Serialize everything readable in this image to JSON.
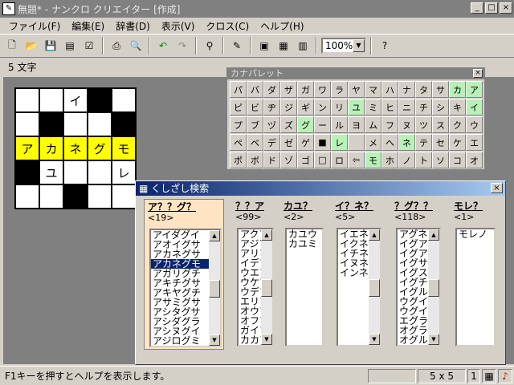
{
  "window": {
    "title": "無題* - ナンクロ クリエイター [作成]",
    "icon": "app-icon"
  },
  "menu": [
    "ファイル(F)",
    "編集(E)",
    "辞書(D)",
    "表示(V)",
    "クロス(C)",
    "ヘルプ(H)"
  ],
  "toolbar": {
    "zoom": "100%"
  },
  "charcount": "5 文字",
  "grid": {
    "cells": [
      [
        "",
        "",
        "イ",
        "#",
        ""
      ],
      [
        "",
        "#",
        "",
        "",
        "#"
      ],
      [
        "ア",
        "カ",
        "ネ",
        "グ",
        "モ"
      ],
      [
        "#",
        "ユ",
        "",
        "",
        "レ"
      ],
      [
        "",
        "",
        "#",
        "",
        ""
      ]
    ],
    "highlight_row": 2
  },
  "palette": {
    "title": "カナパレット",
    "keys": [
      [
        "パ",
        "バ",
        "ダ",
        "ザ",
        "ガ",
        "ワ",
        "ラ",
        "ヤ",
        "マ",
        "ハ",
        "ナ",
        "タ",
        "サ",
        "カ",
        "ア"
      ],
      [
        "ピ",
        "ビ",
        "ヂ",
        "ジ",
        "ギ",
        "ン",
        "リ",
        "ユ",
        "ミ",
        "ヒ",
        "ニ",
        "チ",
        "シ",
        "キ",
        "イ"
      ],
      [
        "プ",
        "ブ",
        "ヅ",
        "ズ",
        "グ",
        "ー",
        "ル",
        "ヨ",
        "ム",
        "フ",
        "ヌ",
        "ツ",
        "ス",
        "ク",
        "ウ"
      ],
      [
        "ペ",
        "ベ",
        "デ",
        "ゼ",
        "ゲ",
        "■",
        "レ",
        "",
        "メ",
        "ヘ",
        "ネ",
        "テ",
        "セ",
        "ケ",
        "エ"
      ],
      [
        "ポ",
        "ボ",
        "ド",
        "ゾ",
        "ゴ",
        "□",
        "ロ",
        "⇦",
        "モ",
        "ホ",
        "ノ",
        "ト",
        "ソ",
        "コ",
        "オ"
      ]
    ],
    "green": [
      "カ",
      "ア",
      "イ",
      "ユ",
      "グ",
      "レ",
      "ネ",
      "モ"
    ]
  },
  "dialog": {
    "title": "くしざし検索",
    "columns": [
      {
        "head": "ア？？グ？",
        "count": "<19>",
        "items": [
          "アイダグイ",
          "アオイグサ",
          "アカネグサ",
          "アカネグモ",
          "アガリグチ",
          "アキチグサ",
          "アキヤグチ",
          "アサミグサ",
          "アシタグサ",
          "アシダグラ",
          "アシヌグイ",
          "アジログミ"
        ],
        "highlight": 3
      },
      {
        "head": "？？ア",
        "count": "<99>",
        "items": [
          "アクア",
          "アジア",
          "アリア",
          "イデア",
          "ウエア",
          "ウケア",
          "ウデア",
          "エリア",
          "オウア",
          "オフア",
          "ガイア",
          "カカア"
        ]
      },
      {
        "head": "カユ？",
        "count": "<2>",
        "items": [
          "カユウ",
          "カユミ"
        ]
      },
      {
        "head": "イ？ネ？",
        "count": "<5>",
        "items": [
          "イエネコ",
          "イクネン",
          "イチネン",
          "イヌネコ",
          "インネン"
        ]
      },
      {
        "head": "？グ？？",
        "count": "<118>",
        "items": [
          "アグネス",
          "イグアス",
          "イグアナ",
          "イグサカ",
          "イグスリ",
          "イグチカ",
          "イグルー",
          "ウグイス",
          "ウグイス",
          "エグラフ",
          "オグラー",
          "オグルス"
        ]
      },
      {
        "head": "モレ？",
        "count": "<1>",
        "items": [
          "モレノ"
        ]
      }
    ]
  },
  "status": {
    "help": "F1キーを押すとヘルプを表示します。",
    "size": "5 x 5",
    "page": "1"
  }
}
